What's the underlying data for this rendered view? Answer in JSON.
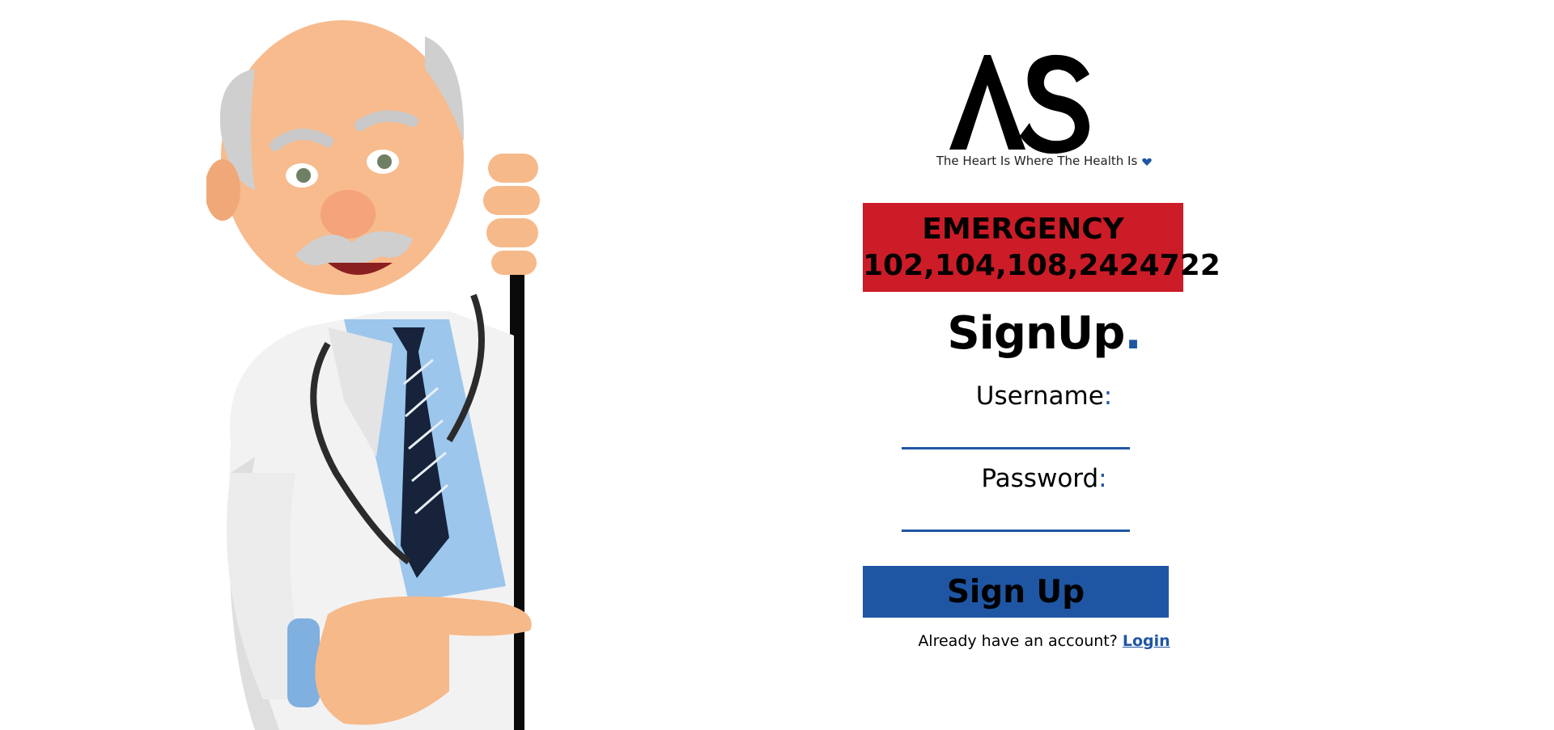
{
  "brand": {
    "logo_text": "AS",
    "tagline": "The Heart Is Where The Health Is"
  },
  "emergency": {
    "title": "EMERGENCY",
    "numbers": "102,104,108,2424722"
  },
  "form": {
    "title": "SignUp",
    "title_dot": ".",
    "username_label": "Username",
    "password_label": "Password",
    "label_colon": ":",
    "submit_label": "Sign Up"
  },
  "footer": {
    "prompt": "Already have an account?",
    "login_link": "Login"
  },
  "colors": {
    "accent": "#1f56a3",
    "emergency": "#cc1c28"
  },
  "icons": {
    "tagline_icon": "heart-icon"
  }
}
